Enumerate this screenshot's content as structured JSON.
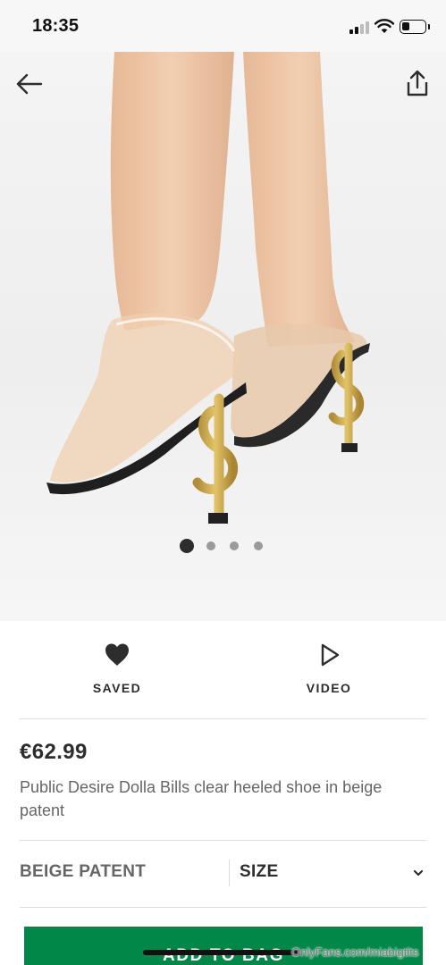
{
  "status_bar": {
    "time": "18:35",
    "icons": [
      "signal-icon",
      "wifi-icon",
      "battery-icon"
    ]
  },
  "hero": {
    "back_icon": "arrow-left-icon",
    "share_icon": "share-icon",
    "image_count": 4,
    "active_image_index": 0
  },
  "actions": {
    "saved_label": "SAVED",
    "saved_icon": "heart-icon",
    "video_label": "VIDEO",
    "video_icon": "play-icon"
  },
  "product": {
    "price": "€62.99",
    "title": "Public Desire Dolla Bills clear heeled shoe in beige patent",
    "colour": "BEIGE PATENT",
    "size_label": "SIZE",
    "size_icon": "chevron-down-icon"
  },
  "cta": {
    "add_to_bag_label": "ADD TO BAG",
    "color": "#018849"
  },
  "watermark": "OnlyFans.com/miabigtits"
}
